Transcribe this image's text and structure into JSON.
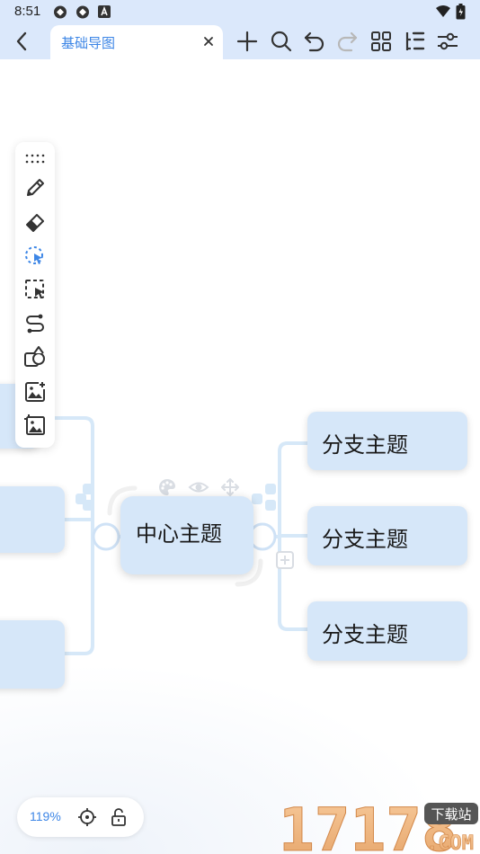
{
  "status": {
    "time": "8:51"
  },
  "tab": {
    "title": "基础导图"
  },
  "toolbar": {
    "icons": [
      "plus-icon",
      "search-icon",
      "undo-icon",
      "redo-icon",
      "grid-icon",
      "outline-icon",
      "settings-sliders-icon"
    ]
  },
  "tools": [
    "drag-handle-icon",
    "pen-icon",
    "eraser-icon",
    "lasso-select-icon",
    "box-select-icon",
    "connector-icon",
    "shapes-icon",
    "add-image-icon",
    "insert-image-icon"
  ],
  "mindmap": {
    "central": "中心主题",
    "branches": [
      "分支主题",
      "分支主题",
      "分支主题"
    ]
  },
  "zoom": {
    "label": "119%"
  },
  "watermark": {
    "text": "17178",
    "badge": "下载站",
    "suffix": ".COM"
  },
  "colors": {
    "accent": "#3d86e6",
    "node_fill": "#d6e7f9",
    "connector": "#cfe2f6",
    "bar_bg": "#dbe8fb"
  }
}
